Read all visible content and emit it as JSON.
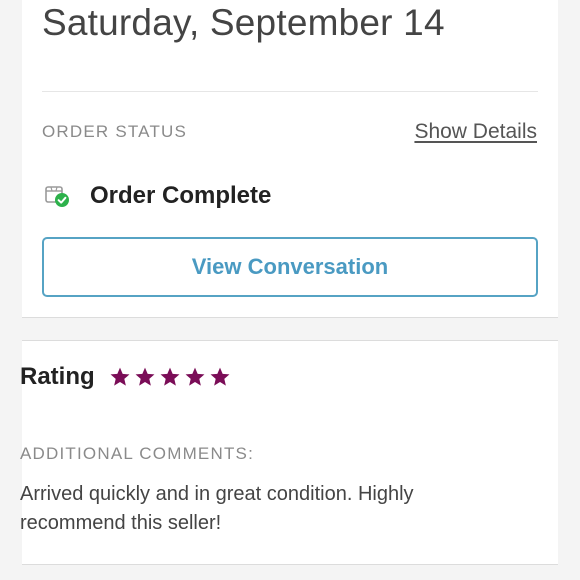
{
  "order": {
    "date": "Saturday, September 14",
    "status_label": "ORDER STATUS",
    "show_details_label": "Show Details",
    "status_icon": "package-check-icon",
    "status_text": "Order Complete",
    "view_conversation_label": "View Conversation"
  },
  "review": {
    "rating_label": "Rating",
    "rating_value": 5,
    "rating_max": 5,
    "star_color": "#7a0d57",
    "comments_label": "ADDITIONAL COMMENTS:",
    "comments_text": "Arrived quickly and in great condition. Highly recommend this seller!"
  },
  "colors": {
    "accent": "#4a9ac2",
    "complete_green": "#2db14b"
  }
}
